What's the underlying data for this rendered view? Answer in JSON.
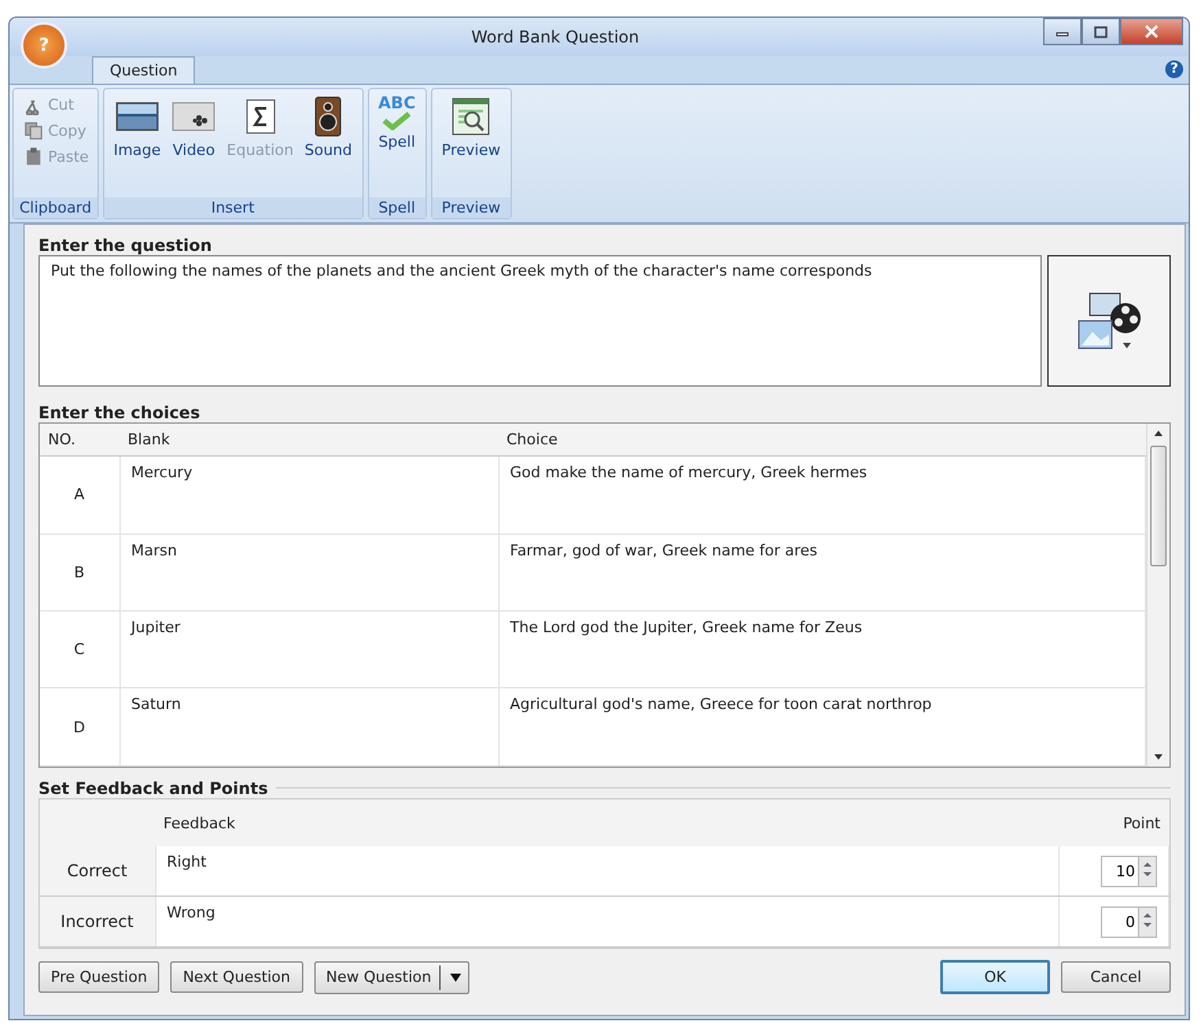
{
  "window": {
    "title": "Word Bank Question",
    "app_glyph": "?"
  },
  "tabs": [
    {
      "label": "Question",
      "selected": true
    }
  ],
  "help": {
    "glyph": "?"
  },
  "ribbon": [
    {
      "label": "Clipboard",
      "kind": "small",
      "items": [
        {
          "label": "Cut",
          "disabled": true
        },
        {
          "label": "Copy",
          "disabled": true
        },
        {
          "label": "Paste",
          "disabled": true
        }
      ]
    },
    {
      "label": "Insert",
      "kind": "large",
      "items": [
        {
          "label": "Image",
          "disabled": false
        },
        {
          "label": "Video",
          "disabled": false
        },
        {
          "label": "Equation",
          "disabled": true
        },
        {
          "label": "Sound",
          "disabled": false
        }
      ]
    },
    {
      "label": "Spell",
      "kind": "large",
      "items": [
        {
          "label": "Spell",
          "disabled": false,
          "icon_text": "ABC"
        }
      ]
    },
    {
      "label": "Preview",
      "kind": "large",
      "items": [
        {
          "label": "Preview",
          "disabled": false
        }
      ]
    }
  ],
  "question": {
    "heading": "Enter the question",
    "value": "Put the following the names of the planets and the ancient Greek myth of the character's name corresponds"
  },
  "choices": {
    "heading": "Enter the choices",
    "columns": [
      "NO.",
      "Blank",
      "Choice"
    ],
    "rows": [
      {
        "no": "A",
        "blank": "Mercury",
        "choice": "God make the name of mercury, Greek hermes"
      },
      {
        "no": "B",
        "blank": "Marsn",
        "choice": "Farmar, god of war, Greek name for ares"
      },
      {
        "no": "C",
        "blank": "Jupiter",
        "choice": "The Lord god the Jupiter, Greek name for Zeus"
      },
      {
        "no": "D",
        "blank": "Saturn",
        "choice": "Agricultural god's name, Greece for toon carat northrop"
      }
    ]
  },
  "feedback": {
    "heading": "Set Feedback and Points",
    "columns": [
      "Feedback",
      "Point"
    ],
    "rows": [
      {
        "label": "Correct",
        "feedback": "Right",
        "point": "10"
      },
      {
        "label": "Incorrect",
        "feedback": "Wrong",
        "point": "0"
      }
    ]
  },
  "buttons_left": [
    {
      "label": "Pre Question",
      "kind": "plain"
    },
    {
      "label": "Next Question",
      "kind": "plain"
    },
    {
      "label": "New Question",
      "kind": "dropdown"
    }
  ],
  "buttons_right": [
    {
      "label": "OK",
      "focused": true
    },
    {
      "label": "Cancel",
      "focused": false
    }
  ]
}
